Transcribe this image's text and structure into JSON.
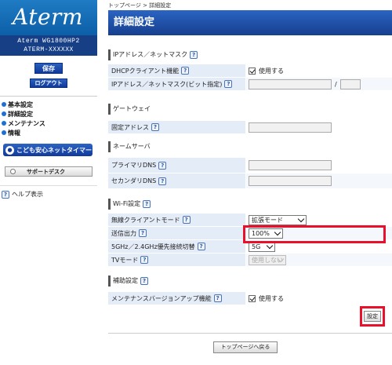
{
  "sidebar": {
    "logo": "Aterm",
    "model_line1": "Aterm WG1800HP2",
    "model_line2": "ATERM-XXXXXX",
    "save_label": "保存",
    "logout_label": "ログアウト",
    "nav": [
      "基本設定",
      "詳細設定",
      "メンテナンス",
      "情報"
    ],
    "kids_label": "こども安心ネットタイマー",
    "support_label": "サポートデスク",
    "help_label": "ヘルプ表示"
  },
  "breadcrumb": "トップページ > 詳細設定",
  "page_title": "詳細設定",
  "sections": {
    "ip": {
      "title": "IPアドレス／ネットマスク",
      "dhcp_label": "DHCPクライアント機能",
      "dhcp_value": "使用する",
      "ip_label": "IPアドレス／ネットマスク(ビット指定)",
      "slash": "/"
    },
    "gateway": {
      "title": "ゲートウェイ",
      "fixed_label": "固定アドレス"
    },
    "dns": {
      "title": "ネームサーバ",
      "primary_label": "プライマリDNS",
      "secondary_label": "セカンダリDNS"
    },
    "wifi": {
      "title": "Wi-Fi設定",
      "mode_label": "無線クライアントモード",
      "mode_value": "拡張モード",
      "power_label": "送信出力",
      "power_value": "100%",
      "band_label": "5GHz／2.4GHz優先接続切替",
      "band_value": "5G",
      "tv_label": "TVモード",
      "tv_value": "使用しない"
    },
    "aux": {
      "title": "補助設定",
      "maint_label": "メンテナンスバージョンアップ機能",
      "maint_value": "使用する"
    }
  },
  "set_label": "設定",
  "back_label": "トップページへ戻る",
  "help_glyph": "?",
  "accent_color": "#1f5bb8",
  "highlight_color": "#e8102b"
}
